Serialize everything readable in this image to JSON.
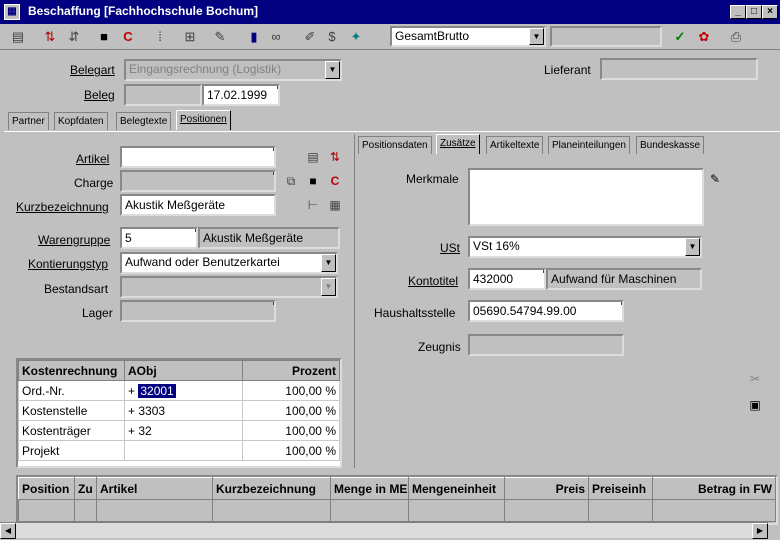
{
  "window": {
    "title": "Beschaffung [Fachhochschule Bochum]",
    "app_icon": "application-icon",
    "buttons": [
      "_",
      "□",
      "×"
    ]
  },
  "toolbar": {
    "icons": [
      "list-icon",
      "sort-up-icon",
      "sort-down-icon",
      "save-icon",
      "copyright-icon",
      "pause-icon",
      "filter-icon",
      "edit-icon",
      "chart-icon",
      "binoculars-icon",
      "pen-icon",
      "dollar-icon",
      "stamp-icon"
    ],
    "combo_value": "GesamtBrutto",
    "right_icons": [
      "checkmark-icon",
      "puzzle-icon",
      "printer-icon"
    ]
  },
  "header": {
    "belegart_label": "Belegart",
    "belegart_value": "Eingangsrechnung (Logistik)",
    "beleg_label": "Beleg",
    "beleg_date": "17.02.1999",
    "lieferant_label": "Lieferant"
  },
  "main_tabs": [
    {
      "label": "Partner"
    },
    {
      "label": "Kopfdaten"
    },
    {
      "label": "Belegtexte"
    },
    {
      "label": "Positionen"
    }
  ],
  "left_form": {
    "artikel_label": "Artikel",
    "charge_label": "Charge",
    "kurzbezeichnung_label": "Kurzbezeichnung",
    "kurzbezeichnung_value": "Akustik Meßgeräte",
    "warengruppe_label": "Warengruppe",
    "warengruppe_value": "5",
    "warengruppe_text": "Akustik Meßgeräte",
    "kontierungstyp_label": "Kontierungstyp",
    "kontierungstyp_value": "Aufwand oder Benutzerkartei",
    "bestandsart_label": "Bestandsart",
    "lager_label": "Lager"
  },
  "kostenrechnung": {
    "headers": [
      "Kostenrechnung",
      "AObj",
      "Prozent"
    ],
    "rows": [
      {
        "name": "Ord.-Nr.",
        "prefix": "+",
        "aobj": "32001",
        "prozent": "100,00 %"
      },
      {
        "name": "Kostenstelle",
        "prefix": "+",
        "aobj": "3303",
        "prozent": "100,00 %"
      },
      {
        "name": "Kostenträger",
        "prefix": "+",
        "aobj": "32",
        "prozent": "100,00 %"
      },
      {
        "name": "Projekt",
        "prefix": "",
        "aobj": "",
        "prozent": "100,00 %"
      }
    ]
  },
  "right_tabs": [
    {
      "label": "Positionsdaten"
    },
    {
      "label": "Zusätze"
    },
    {
      "label": "Artikeltexte"
    },
    {
      "label": "Planeinteilungen"
    },
    {
      "label": "Bundeskasse"
    }
  ],
  "right_form": {
    "merkmale_label": "Merkmale",
    "ust_label": "USt",
    "ust_value": "VSt 16%",
    "kontotitel_label": "Kontotitel",
    "kontotitel_value": "432000",
    "kontotitel_text": "Aufwand für Maschinen",
    "haushaltsstelle_label": "Haushaltsstelle",
    "haushaltsstelle_value": "05690.54794.99.00",
    "zeugnis_label": "Zeugnis"
  },
  "positions_list": {
    "headers": [
      "Position",
      "Zu",
      "Artikel",
      "Kurzbezeichnung",
      "Menge in ME",
      "Mengeneinheit",
      "Preis",
      "Preiseinh",
      "Betrag in FW"
    ]
  }
}
